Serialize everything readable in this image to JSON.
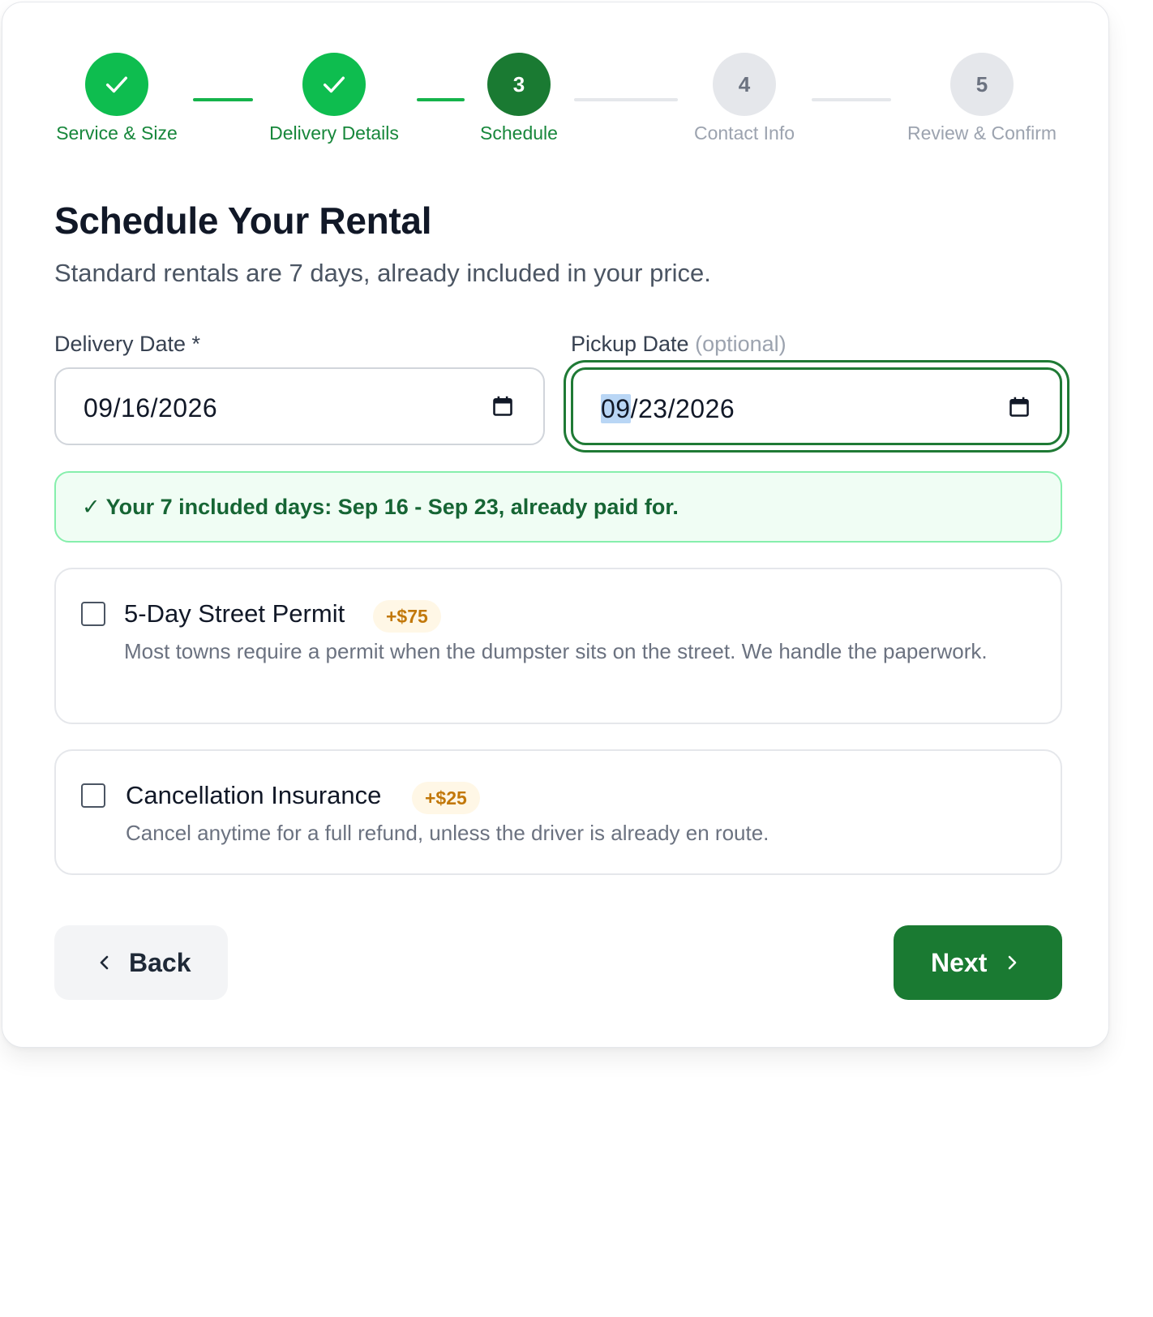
{
  "stepper": {
    "steps": [
      {
        "number": "1",
        "label": "Service & Size",
        "status": "completed",
        "icon": "check-icon"
      },
      {
        "number": "2",
        "label": "Delivery Details",
        "status": "completed",
        "icon": "check-icon"
      },
      {
        "number": "3",
        "label": "Schedule",
        "status": "active"
      },
      {
        "number": "4",
        "label": "Contact Info",
        "status": "upcoming"
      },
      {
        "number": "5",
        "label": "Review & Confirm",
        "status": "upcoming"
      }
    ]
  },
  "page": {
    "title": "Schedule Your Rental",
    "subtitle": "Standard rentals are 7 days, already included in your price."
  },
  "delivery_date": {
    "label": "Delivery Date *",
    "value": "09/16/2026",
    "icon": "calendar-icon"
  },
  "pickup_date": {
    "label": "Pickup Date",
    "optional_note": "(optional)",
    "value_month": "09",
    "value_rest": "/23/2026",
    "icon": "calendar-icon",
    "focused": true
  },
  "notice": {
    "text": "✓ Your 7 included days: Sep 16 - Sep 23, already paid for."
  },
  "addons": [
    {
      "title": "5-Day Street Permit",
      "price": "+$75",
      "description": "Most towns require a permit when the dumpster sits on the street. We handle the paperwork.",
      "checked": false
    },
    {
      "title": "Cancellation Insurance",
      "price": "+$25",
      "description": "Cancel anytime for a full refund, unless the driver is already en route.",
      "checked": false
    }
  ],
  "actions": {
    "back_label": "Back",
    "next_label": "Next"
  },
  "colors": {
    "primary_green": "#1a7a32",
    "completed_green": "#0ebd4f",
    "step_text_green": "#17873b",
    "notice_bg": "#f0fdf4",
    "notice_border": "#86efac",
    "price_badge_text": "#c2780a"
  }
}
